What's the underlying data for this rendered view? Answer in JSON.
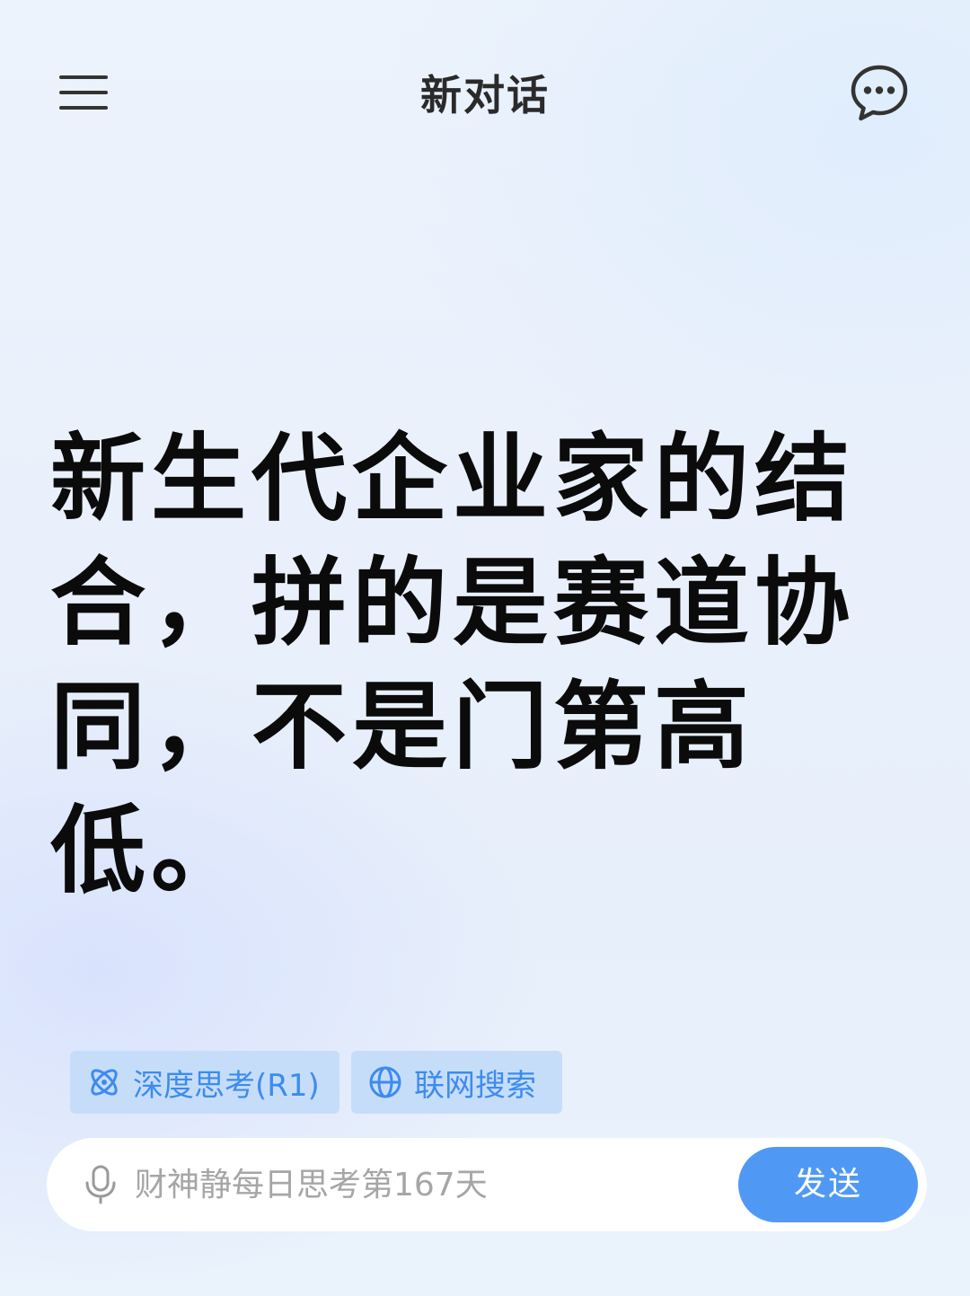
{
  "header": {
    "title": "新对话",
    "menu_icon": "menu-icon",
    "chat_icon": "chat-bubble-icon"
  },
  "headline": {
    "lines": [
      "新生代企业家的结",
      "合，拼的是赛道协",
      "同，不是门第高低。"
    ]
  },
  "options": {
    "deep_think_label": "深度思考(R1)",
    "deep_think_icon": "atom-icon",
    "web_search_label": "联网搜索",
    "web_search_icon": "globe-icon"
  },
  "composer": {
    "placeholder": "财神静每日思考第167天",
    "mic_icon": "microphone-icon",
    "send_label": "发送"
  },
  "colors": {
    "accent": "#4f99f4",
    "chip_bg": "#c6ddf9",
    "chip_text": "#3d8bf0",
    "headline": "#0b0b0b"
  }
}
